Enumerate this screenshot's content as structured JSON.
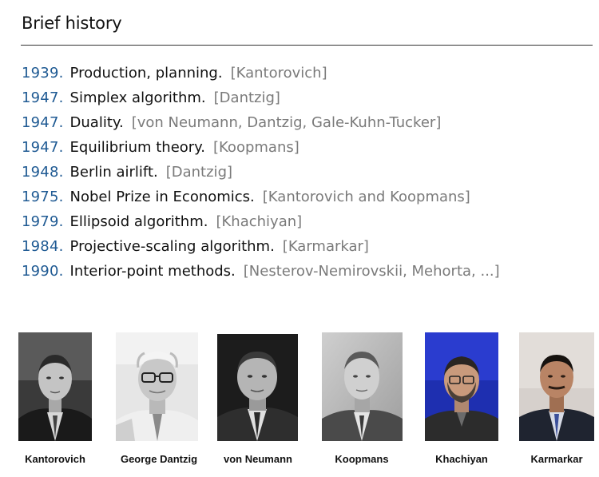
{
  "slide": {
    "title": "Brief history"
  },
  "timeline": [
    {
      "year": "1939.",
      "event": "Production, planning.",
      "credit": "[Kantorovich]"
    },
    {
      "year": "1947.",
      "event": "Simplex algorithm.",
      "credit": "[Dantzig]"
    },
    {
      "year": "1947.",
      "event": "Duality.",
      "credit": "[von Neumann, Dantzig, Gale-Kuhn-Tucker]"
    },
    {
      "year": "1947.",
      "event": "Equilibrium theory.",
      "credit": "[Koopmans]"
    },
    {
      "year": "1948.",
      "event": "Berlin airlift.",
      "credit": "[Dantzig]"
    },
    {
      "year": "1975.",
      "event": "Nobel Prize in Economics.",
      "credit": "[Kantorovich and Koopmans]"
    },
    {
      "year": "1979.",
      "event": "Ellipsoid algorithm.",
      "credit": "[Khachiyan]"
    },
    {
      "year": "1984.",
      "event": "Projective-scaling algorithm.",
      "credit": "[Karmarkar]"
    },
    {
      "year": "1990.",
      "event": "Interior-point methods.",
      "credit": "[Nesterov-Nemirovskii, Mehorta, ...]"
    }
  ],
  "people": [
    {
      "name": "Kantorovich",
      "photo": "bw"
    },
    {
      "name": "George Dantzig",
      "photo": "bw"
    },
    {
      "name": "von Neumann",
      "photo": "bw"
    },
    {
      "name": "Koopmans",
      "photo": "bw"
    },
    {
      "name": "Khachiyan",
      "photo": "color-blue-backdrop"
    },
    {
      "name": "Karmarkar",
      "photo": "color-light-backdrop"
    }
  ],
  "colors": {
    "year": "#1f5a93",
    "credit": "#7a7a7a",
    "text": "#111111"
  }
}
